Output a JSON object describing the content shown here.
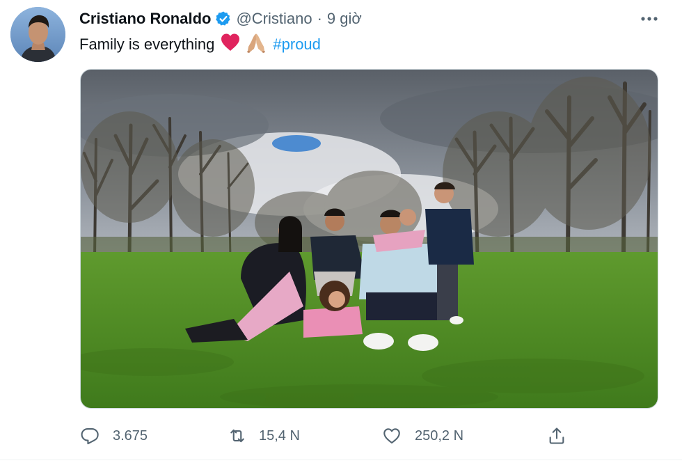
{
  "tweet": {
    "author_name": "Cristiano Ronaldo",
    "handle": "@Cristiano",
    "separator": "·",
    "time": "9 giờ",
    "text": "Family is everything",
    "hashtag": "#proud"
  },
  "actions": {
    "reply_count": "3.675",
    "retweet_count": "15,4 N",
    "like_count": "250,2 N"
  },
  "icons": [
    "verified-badge-icon",
    "more-icon",
    "heart-emoji",
    "folded-hands-emoji",
    "reply-icon",
    "retweet-icon",
    "like-icon",
    "share-icon"
  ],
  "colors": {
    "accent": "#1d9bf0",
    "secondary_text": "#536471",
    "text": "#0f1419",
    "heart_emoji": "#e0245e"
  }
}
